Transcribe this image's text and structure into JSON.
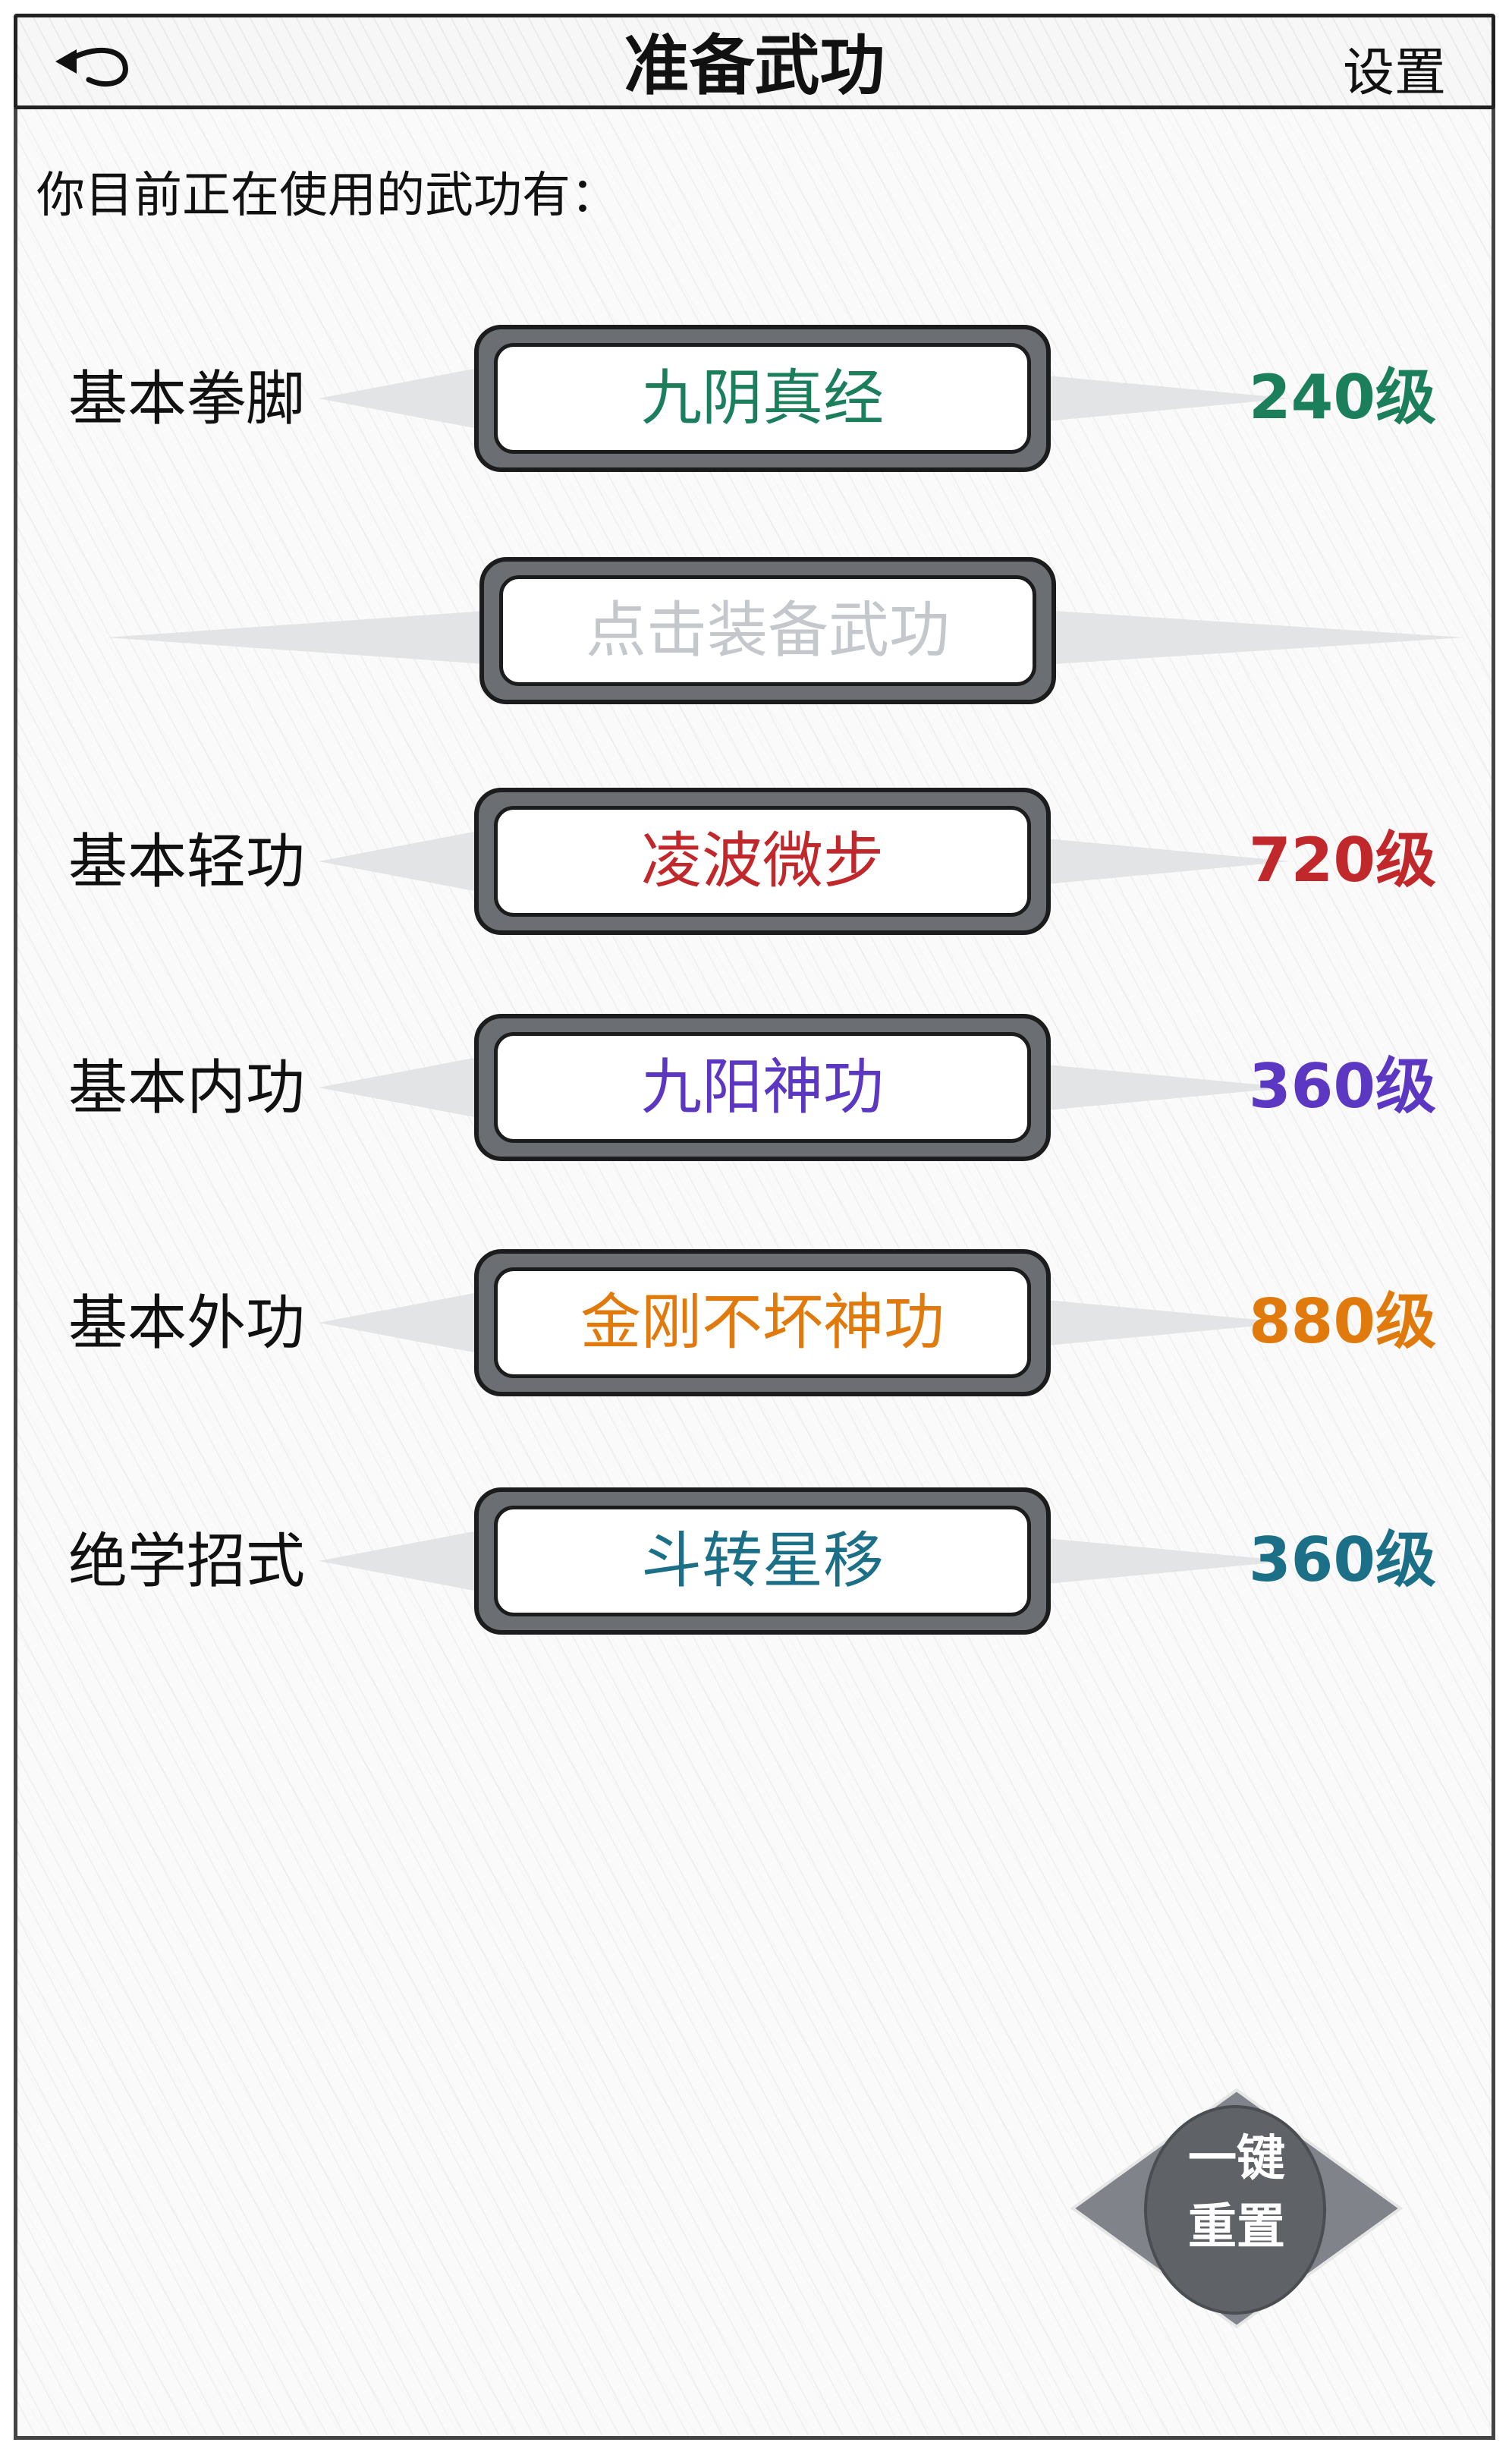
{
  "header": {
    "title": "准备武功",
    "settings_label": "设置",
    "back_icon": "back-arrow-icon"
  },
  "intro_text": "你目前正在使用的武功有：",
  "rows": [
    {
      "category": "基本拳脚",
      "skill": "九阴真经",
      "level": "240级",
      "color": "#1b7f5c"
    },
    {
      "category": "",
      "skill": "点击装备武功",
      "level": "",
      "color": "#c4c8cc"
    },
    {
      "category": "基本轻功",
      "skill": "凌波微步",
      "level": "720级",
      "color": "#c0282b"
    },
    {
      "category": "基本内功",
      "skill": "九阳神功",
      "level": "360级",
      "color": "#5b37c2"
    },
    {
      "category": "基本外功",
      "skill": "金刚不坏神功",
      "level": "880级",
      "color": "#e07a0c"
    },
    {
      "category": "绝学招式",
      "skill": "斗转星移",
      "level": "360级",
      "color": "#1b6f86"
    }
  ],
  "reset_button": {
    "line1": "一键",
    "line2": "重置"
  }
}
